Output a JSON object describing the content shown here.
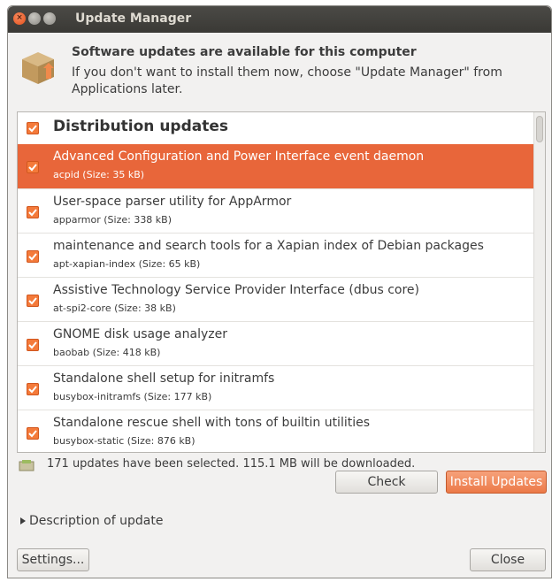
{
  "window": {
    "title": "Update Manager"
  },
  "header": {
    "title": "Software updates are available for this computer",
    "text": "If you don't want to install them now, choose \"Update Manager\" from Applications later."
  },
  "list": {
    "group_label": "Distribution updates",
    "items": [
      {
        "name": "Advanced Configuration and Power Interface event daemon",
        "detail": "acpid (Size: 35 kB)",
        "checked": true,
        "selected": true
      },
      {
        "name": "User-space parser utility for AppArmor",
        "detail": "apparmor (Size: 338 kB)",
        "checked": true,
        "selected": false
      },
      {
        "name": "maintenance and search tools for a Xapian index of Debian packages",
        "detail": "apt-xapian-index (Size: 65 kB)",
        "checked": true,
        "selected": false
      },
      {
        "name": "Assistive Technology Service Provider Interface (dbus core)",
        "detail": "at-spi2-core (Size: 38 kB)",
        "checked": true,
        "selected": false
      },
      {
        "name": "GNOME disk usage analyzer",
        "detail": "baobab (Size: 418 kB)",
        "checked": true,
        "selected": false
      },
      {
        "name": "Standalone shell setup for initramfs",
        "detail": "busybox-initramfs (Size: 177 kB)",
        "checked": true,
        "selected": false
      },
      {
        "name": "Standalone rescue shell with tons of builtin utilities",
        "detail": "busybox-static (Size: 876 kB)",
        "checked": true,
        "selected": false
      }
    ]
  },
  "status": {
    "text": "171 updates have been selected. 115.1 MB will be downloaded."
  },
  "buttons": {
    "check": "Check",
    "install": "Install Updates",
    "settings": "Settings...",
    "close": "Close"
  },
  "expander": {
    "label": "Description of update"
  },
  "colors": {
    "accent": "#e8663a",
    "checkbox": "#f47a3a",
    "title_bar": "#3c3b37"
  },
  "icons": [
    "close-window-icon",
    "minimize-window-icon",
    "maximize-window-icon",
    "package-update-icon",
    "checkbox-checked-icon",
    "download-status-icon",
    "expander-arrow-icon"
  ]
}
